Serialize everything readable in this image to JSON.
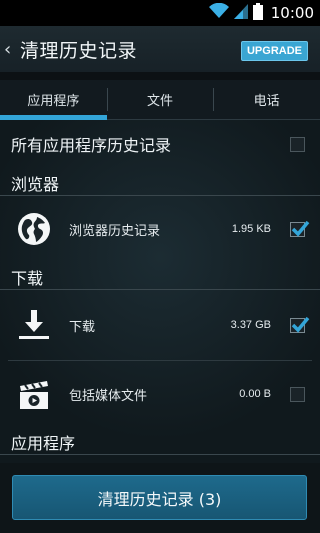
{
  "status_bar": {
    "time": "10:00"
  },
  "action_bar": {
    "title": "清理历史记录",
    "upgrade_label": "UPGRADE"
  },
  "tabs": [
    {
      "label": "应用程序",
      "active": true
    },
    {
      "label": "文件",
      "active": false
    },
    {
      "label": "电话",
      "active": false
    }
  ],
  "all_apps": {
    "label": "所有应用程序历史记录",
    "checked": false
  },
  "sections": {
    "browser": {
      "title": "浏览器",
      "items": [
        {
          "label": "浏览器历史记录",
          "size": "1.95 KB",
          "checked": true,
          "icon": "globe-icon"
        }
      ]
    },
    "download": {
      "title": "下载",
      "items": [
        {
          "label": "下载",
          "size": "3.37 GB",
          "checked": true,
          "icon": "download-icon"
        },
        {
          "label": "包括媒体文件",
          "size": "0.00 B",
          "checked": false,
          "icon": "media-clapper-icon"
        }
      ]
    },
    "apps": {
      "title": "应用程序"
    }
  },
  "clean_button": {
    "label": "清理历史记录 (3)"
  },
  "colors": {
    "accent": "#33a5d8",
    "upgrade_badge": "#3aa6d3",
    "button": "#1e6a8c"
  }
}
